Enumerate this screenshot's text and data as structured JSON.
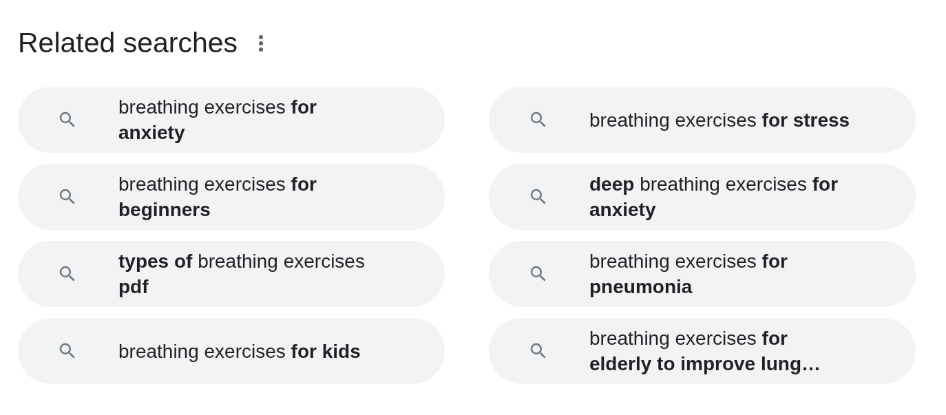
{
  "title": "Related searches",
  "suggestions": [
    {
      "lines": [
        "breathing exercises **for**",
        "**anxiety**"
      ]
    },
    {
      "lines": [
        "breathing exercises **for**",
        "**beginners**"
      ]
    },
    {
      "lines": [
        "**types of** breathing exercises",
        "**pdf**"
      ]
    },
    {
      "lines": [
        "breathing exercises **for kids**"
      ]
    },
    {
      "lines": [
        "breathing exercises **for stress**"
      ]
    },
    {
      "lines": [
        "**deep** breathing exercises **for**",
        "**anxiety**"
      ]
    },
    {
      "lines": [
        "breathing exercises **for**",
        "**pneumonia**"
      ]
    },
    {
      "lines": [
        "breathing exercises **for**",
        "**elderly to improve lung…**"
      ]
    }
  ]
}
